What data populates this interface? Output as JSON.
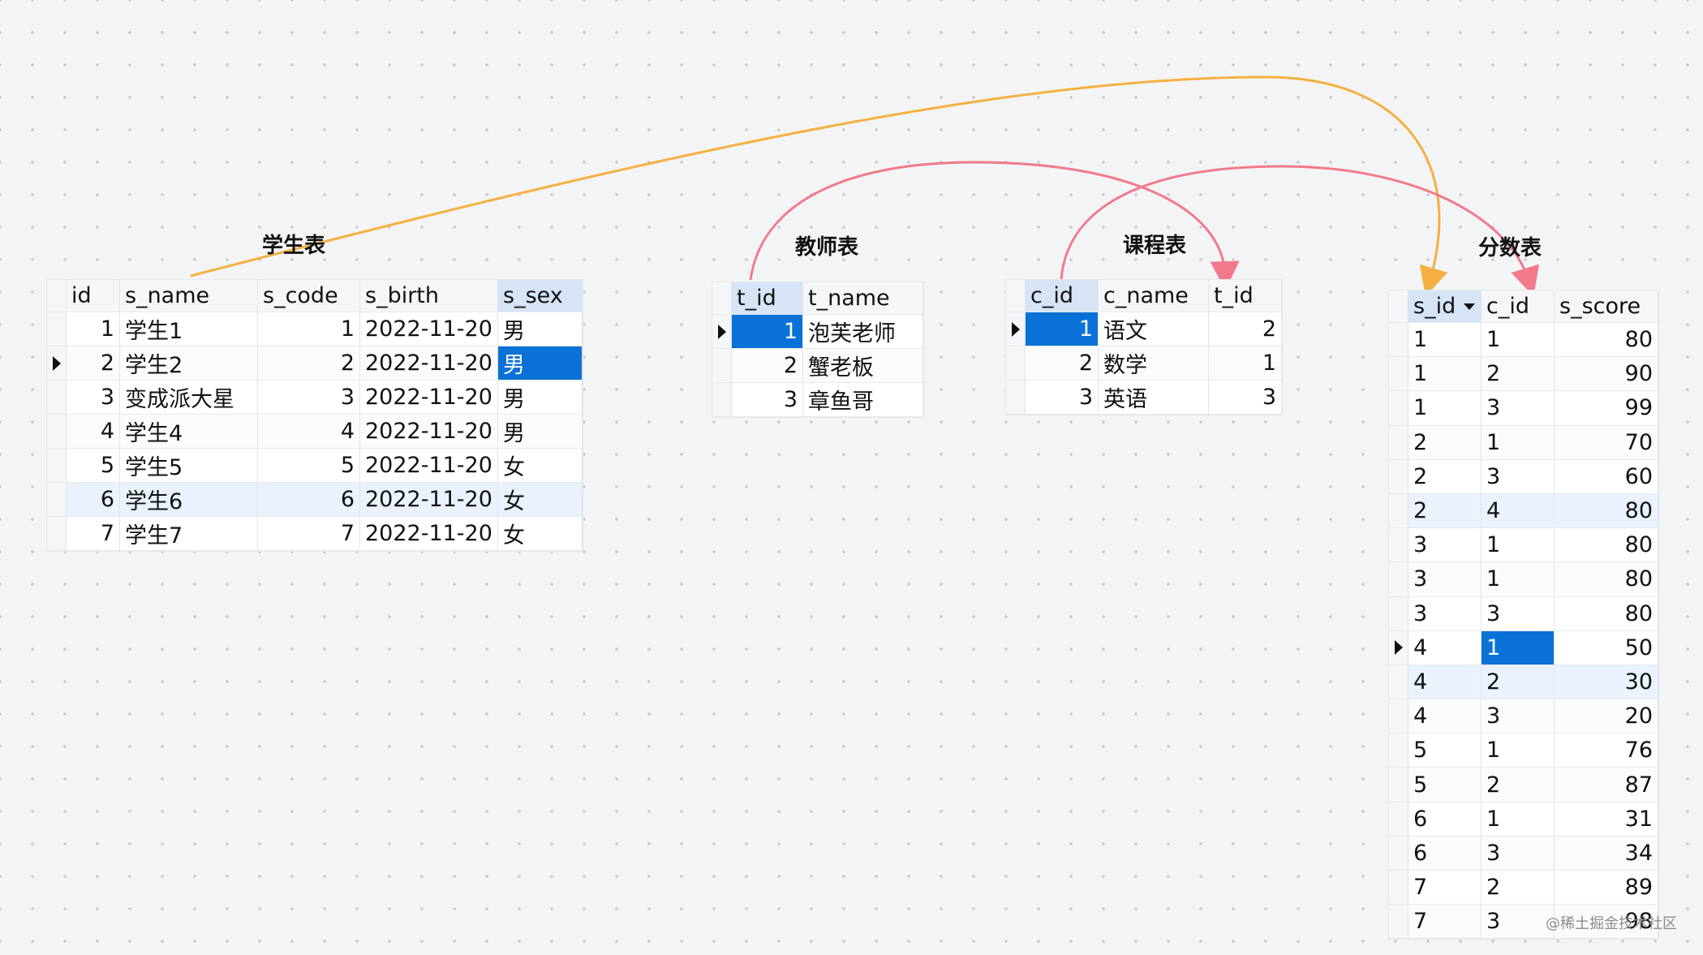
{
  "titles": {
    "student": "学生表",
    "teacher": "教师表",
    "course": "课程表",
    "score": "分数表"
  },
  "student": {
    "headers": [
      "id",
      "s_name",
      "s_code",
      "s_birth",
      "s_sex"
    ],
    "rows": [
      [
        "1",
        "学生1",
        "1",
        "2022-11-20",
        "男"
      ],
      [
        "2",
        "学生2",
        "2",
        "2022-11-20",
        "男"
      ],
      [
        "3",
        "变成派大星",
        "3",
        "2022-11-20",
        "男"
      ],
      [
        "4",
        "学生4",
        "4",
        "2022-11-20",
        "男"
      ],
      [
        "5",
        "学生5",
        "5",
        "2022-11-20",
        "女"
      ],
      [
        "6",
        "学生6",
        "6",
        "2022-11-20",
        "女"
      ],
      [
        "7",
        "学生7",
        "7",
        "2022-11-20",
        "女"
      ]
    ]
  },
  "teacher": {
    "headers": [
      "t_id",
      "t_name"
    ],
    "rows": [
      [
        "1",
        "泡芙老师"
      ],
      [
        "2",
        "蟹老板"
      ],
      [
        "3",
        "章鱼哥"
      ]
    ]
  },
  "course": {
    "headers": [
      "c_id",
      "c_name",
      "t_id"
    ],
    "rows": [
      [
        "1",
        "语文",
        "2"
      ],
      [
        "2",
        "数学",
        "1"
      ],
      [
        "3",
        "英语",
        "3"
      ]
    ]
  },
  "score": {
    "headers": [
      "s_id",
      "c_id",
      "s_score"
    ],
    "rows": [
      [
        "1",
        "1",
        "80"
      ],
      [
        "1",
        "2",
        "90"
      ],
      [
        "1",
        "3",
        "99"
      ],
      [
        "2",
        "1",
        "70"
      ],
      [
        "2",
        "3",
        "60"
      ],
      [
        "2",
        "4",
        "80"
      ],
      [
        "3",
        "1",
        "80"
      ],
      [
        "3",
        "1",
        "80"
      ],
      [
        "3",
        "3",
        "80"
      ],
      [
        "4",
        "1",
        "50"
      ],
      [
        "4",
        "2",
        "30"
      ],
      [
        "4",
        "3",
        "20"
      ],
      [
        "5",
        "1",
        "76"
      ],
      [
        "5",
        "2",
        "87"
      ],
      [
        "6",
        "1",
        "31"
      ],
      [
        "6",
        "3",
        "34"
      ],
      [
        "7",
        "2",
        "89"
      ],
      [
        "7",
        "3",
        "98"
      ]
    ]
  },
  "watermark": "@稀土掘金技术社区",
  "colors": {
    "link_orange": "#f5b041",
    "link_pink": "#f27a8a",
    "selection": "#0a72d7"
  }
}
